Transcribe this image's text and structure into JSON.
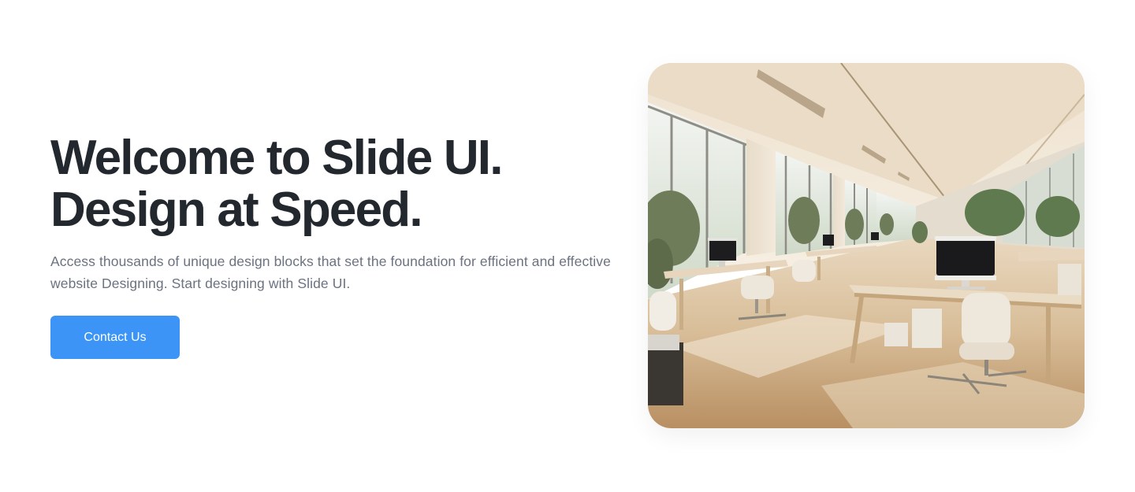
{
  "hero": {
    "title_line1": "Welcome to Slide UI.",
    "title_line2": "Design at Speed.",
    "description": "Access thousands of unique design blocks that set the foundation for efficient and effective website Designing. Start designing with Slide UI.",
    "cta_label": "Contact Us"
  },
  "colors": {
    "heading": "#23272e",
    "body_text": "#6b7280",
    "accent": "#3b94f6",
    "background": "#ffffff"
  }
}
